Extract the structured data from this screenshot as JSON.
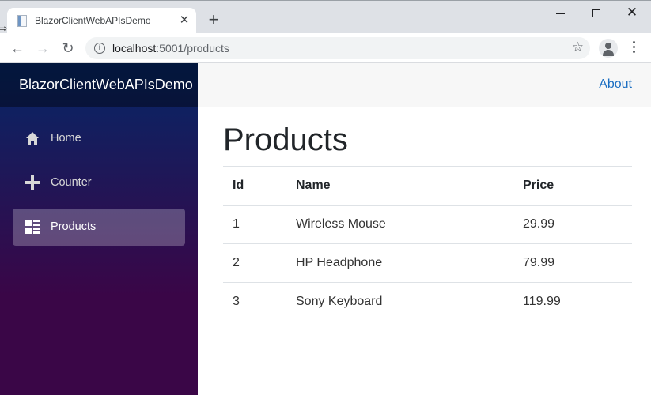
{
  "browser": {
    "tab_title": "BlazorClientWebAPIsDemo",
    "tab_close": "✕",
    "new_tab": "+",
    "url_host": "localhost",
    "url_path": ":5001/products",
    "window_controls": {
      "close": "✕"
    },
    "icons": {
      "back": "←",
      "forward": "→",
      "reload": "↻",
      "star": "☆",
      "info": "i"
    }
  },
  "sidebar": {
    "brand": "BlazorClientWebAPIsDemo",
    "items": [
      {
        "label": "Home",
        "icon": "home-icon",
        "active": false
      },
      {
        "label": "Counter",
        "icon": "plus-icon",
        "active": false
      },
      {
        "label": "Products",
        "icon": "list-rich-icon",
        "active": true
      }
    ]
  },
  "topbar": {
    "about_label": "About"
  },
  "page": {
    "title": "Products",
    "table": {
      "headers": [
        "Id",
        "Name",
        "Price"
      ],
      "rows": [
        [
          "1",
          "Wireless Mouse",
          "29.99"
        ],
        [
          "2",
          "HP Headphone",
          "79.99"
        ],
        [
          "3",
          "Sony Keyboard",
          "119.99"
        ]
      ]
    }
  },
  "colors": {
    "accent": "#1b6ec2",
    "sidebar_top": "#052767",
    "sidebar_bottom": "#3a0647"
  }
}
